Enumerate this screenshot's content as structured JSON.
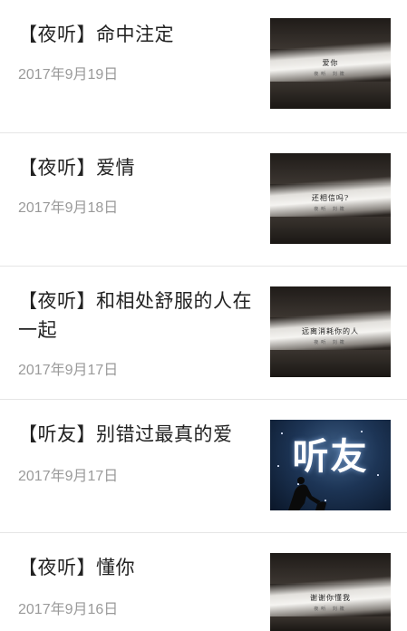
{
  "articles": [
    {
      "title": "【夜听】命中注定",
      "date": "2017年9月19日",
      "thumb_caption": "爱你",
      "thumb_sub": "夜听 刘筱"
    },
    {
      "title": "【夜听】爱情",
      "date": "2017年9月18日",
      "thumb_caption": "还相信吗?",
      "thumb_sub": "夜听 刘筱"
    },
    {
      "title": "【夜听】和相处舒服的人在一起",
      "date": "2017年9月17日",
      "thumb_caption": "远离消耗你的人",
      "thumb_sub": "夜听 刘筱"
    },
    {
      "title": "【听友】别错过最真的爱",
      "date": "2017年9月17日",
      "thumb_caption": "听友"
    },
    {
      "title": "【夜听】懂你",
      "date": "2017年9月16日",
      "thumb_caption": "谢谢你懂我",
      "thumb_sub": "夜听 刘筱"
    }
  ],
  "colors": {
    "title": "#222222",
    "date": "#9a9a9a",
    "divider": "#e6e6e6"
  }
}
